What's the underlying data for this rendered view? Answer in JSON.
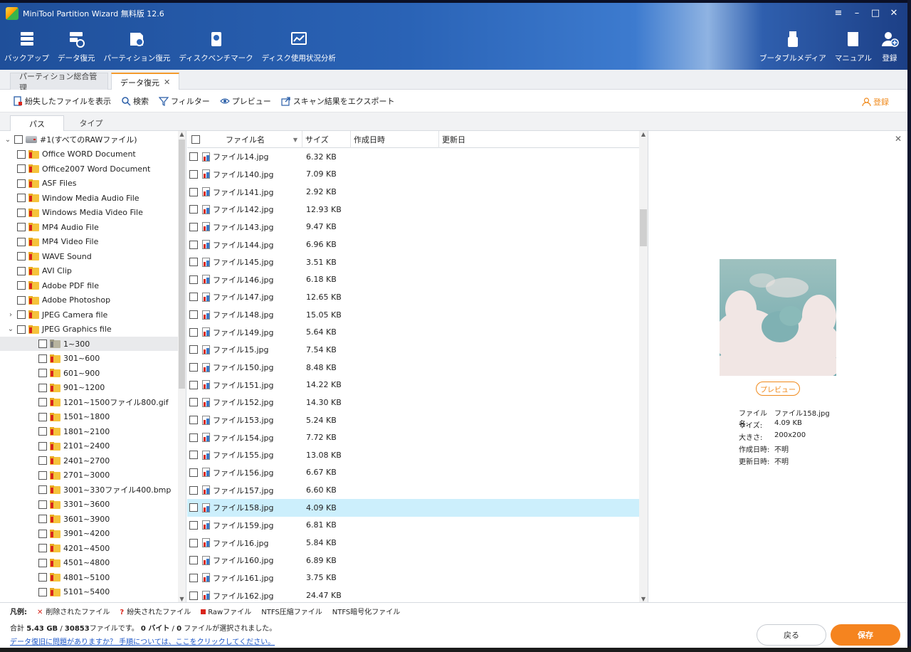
{
  "app": {
    "title": "MiniTool Partition Wizard 無料版 12.6"
  },
  "window_controls": [
    "≡",
    "–",
    "□",
    "✕"
  ],
  "toolbar": {
    "left": [
      {
        "label": "バックアップ",
        "icon": "backup-icon"
      },
      {
        "label": "データ復元",
        "icon": "data-recovery-icon"
      },
      {
        "label": "パーティション復元",
        "icon": "partition-recovery-icon"
      },
      {
        "label": "ディスクベンチマーク",
        "icon": "disk-benchmark-icon"
      },
      {
        "label": "ディスク使用状況分析",
        "icon": "space-analyzer-icon"
      }
    ],
    "right": [
      {
        "label": "ブータブルメディア",
        "icon": "bootable-media-icon"
      },
      {
        "label": "マニュアル",
        "icon": "manual-icon"
      },
      {
        "label": "登録",
        "icon": "register-user-icon"
      }
    ]
  },
  "main_tabs": [
    {
      "label": "パーティション総合管理"
    },
    {
      "label": "データ復元",
      "close": "✕"
    }
  ],
  "actions": [
    {
      "label": "紛失したファイルを表示",
      "icon": "show-lost-files-icon"
    },
    {
      "label": "検索",
      "icon": "search-icon"
    },
    {
      "label": "フィルター",
      "icon": "filter-icon"
    },
    {
      "label": "プレビュー",
      "icon": "eye-icon"
    },
    {
      "label": "スキャン結果をエクスポート",
      "icon": "export-icon"
    }
  ],
  "login_action": "登録",
  "sub_tabs": [
    "パス",
    "タイプ"
  ],
  "tree": {
    "root": "#1(すべてのRAWファイル)",
    "items": [
      "Office WORD Document",
      "Office2007 Word Document",
      "ASF Files",
      "Window Media Audio File",
      "Windows Media Video File",
      "MP4 Audio File",
      "MP4 Video File",
      "WAVE Sound",
      "AVI Clip",
      "Adobe PDF file",
      "Adobe Photoshop",
      "JPEG Camera file",
      "JPEG Graphics file"
    ],
    "sub_items": [
      "1~300",
      "301~600",
      "601~900",
      "901~1200",
      "1201~1500ファイル800.gif",
      "1501~1800",
      "1801~2100",
      "2101~2400",
      "2401~2700",
      "2701~3000",
      "3001~330ファイル400.bmp",
      "3301~3600",
      "3601~3900",
      "3901~4200",
      "4201~4500",
      "4501~4800",
      "4801~5100",
      "5101~5400"
    ]
  },
  "file_list": {
    "columns": [
      "ファイル名",
      "サイズ",
      "作成日時",
      "更新日"
    ],
    "rows": [
      {
        "name": "ファイル14.jpg",
        "size": "6.32 KB"
      },
      {
        "name": "ファイル140.jpg",
        "size": "7.09 KB"
      },
      {
        "name": "ファイル141.jpg",
        "size": "2.92 KB"
      },
      {
        "name": "ファイル142.jpg",
        "size": "12.93 KB"
      },
      {
        "name": "ファイル143.jpg",
        "size": "9.47 KB"
      },
      {
        "name": "ファイル144.jpg",
        "size": "6.96 KB"
      },
      {
        "name": "ファイル145.jpg",
        "size": "3.51 KB"
      },
      {
        "name": "ファイル146.jpg",
        "size": "6.18 KB"
      },
      {
        "name": "ファイル147.jpg",
        "size": "12.65 KB"
      },
      {
        "name": "ファイル148.jpg",
        "size": "15.05 KB"
      },
      {
        "name": "ファイル149.jpg",
        "size": "5.64 KB"
      },
      {
        "name": "ファイル15.jpg",
        "size": "7.54 KB"
      },
      {
        "name": "ファイル150.jpg",
        "size": "8.48 KB"
      },
      {
        "name": "ファイル151.jpg",
        "size": "14.22 KB"
      },
      {
        "name": "ファイル152.jpg",
        "size": "14.30 KB"
      },
      {
        "name": "ファイル153.jpg",
        "size": "5.24 KB"
      },
      {
        "name": "ファイル154.jpg",
        "size": "7.72 KB"
      },
      {
        "name": "ファイル155.jpg",
        "size": "13.08 KB"
      },
      {
        "name": "ファイル156.jpg",
        "size": "6.67 KB"
      },
      {
        "name": "ファイル157.jpg",
        "size": "6.60 KB"
      },
      {
        "name": "ファイル158.jpg",
        "size": "4.09 KB",
        "selected": true
      },
      {
        "name": "ファイル159.jpg",
        "size": "6.81 KB"
      },
      {
        "name": "ファイル16.jpg",
        "size": "5.84 KB"
      },
      {
        "name": "ファイル160.jpg",
        "size": "6.89 KB"
      },
      {
        "name": "ファイル161.jpg",
        "size": "3.75 KB"
      },
      {
        "name": "ファイル162.jpg",
        "size": "24.47 KB"
      }
    ]
  },
  "preview": {
    "button": "プレビュー",
    "info": [
      {
        "k": "ファイル名:",
        "v": "ファイル158.jpg"
      },
      {
        "k": "サイズ:",
        "v": "4.09 KB"
      },
      {
        "k": "大きさ:",
        "v": "200x200"
      },
      {
        "k": "作成日時:",
        "v": "不明"
      },
      {
        "k": "更新日時:",
        "v": "不明"
      }
    ]
  },
  "legend": {
    "title": "凡例:",
    "deleted": "削除されたファイル",
    "lost": "紛失されたファイル",
    "raw": "Rawファイル",
    "ntfs_compressed": "NTFS圧縮ファイル",
    "ntfs_encrypted": "NTFS暗号化ファイル"
  },
  "summary": {
    "prefix": "合計 ",
    "total_size": "5.43 GB",
    "sep1": " / ",
    "file_count": "30853",
    "mid": "ファイルです。",
    "selected_bytes": "0 バイト",
    "sep2": " / ",
    "selected_count": "0",
    "suffix": " ファイルが選択されました。"
  },
  "help_link": "データ復旧に問題がありますか？ 手順については、ここをクリックしてください。",
  "buttons": {
    "back": "戻る",
    "save": "保存"
  },
  "colors": {
    "accent": "#f5841f",
    "selected_row": "#cceffc",
    "header_blue": "#2a63b6"
  }
}
